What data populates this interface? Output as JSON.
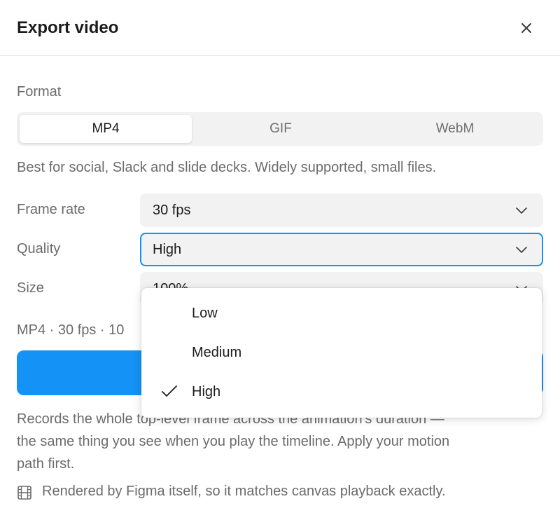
{
  "header": {
    "title": "Export video"
  },
  "format": {
    "label": "Format",
    "options": [
      "MP4",
      "GIF",
      "WebM"
    ],
    "selected": "MP4",
    "description": "Best for social, Slack and slide decks. Widely supported, small files."
  },
  "frame_rate": {
    "label": "Frame rate",
    "value": "30 fps"
  },
  "quality": {
    "label": "Quality",
    "value": "High",
    "options": [
      "Low",
      "Medium",
      "High"
    ]
  },
  "size": {
    "label": "Size",
    "value": "100%"
  },
  "summary": "MP4 · 30 fps · 10",
  "notes": {
    "line1": "Records the whole top-level frame across the animation's duration —",
    "line2": "the same thing you see when you play the timeline. Apply your motion",
    "line3": "path first."
  },
  "footnote": "Rendered by Figma itself, so it matches canvas playback exactly.",
  "icons": {
    "close": "close-icon",
    "chevron": "chevron-down-icon",
    "check": "check-icon",
    "film": "film-icon"
  },
  "colors": {
    "accent": "#1592f5"
  }
}
